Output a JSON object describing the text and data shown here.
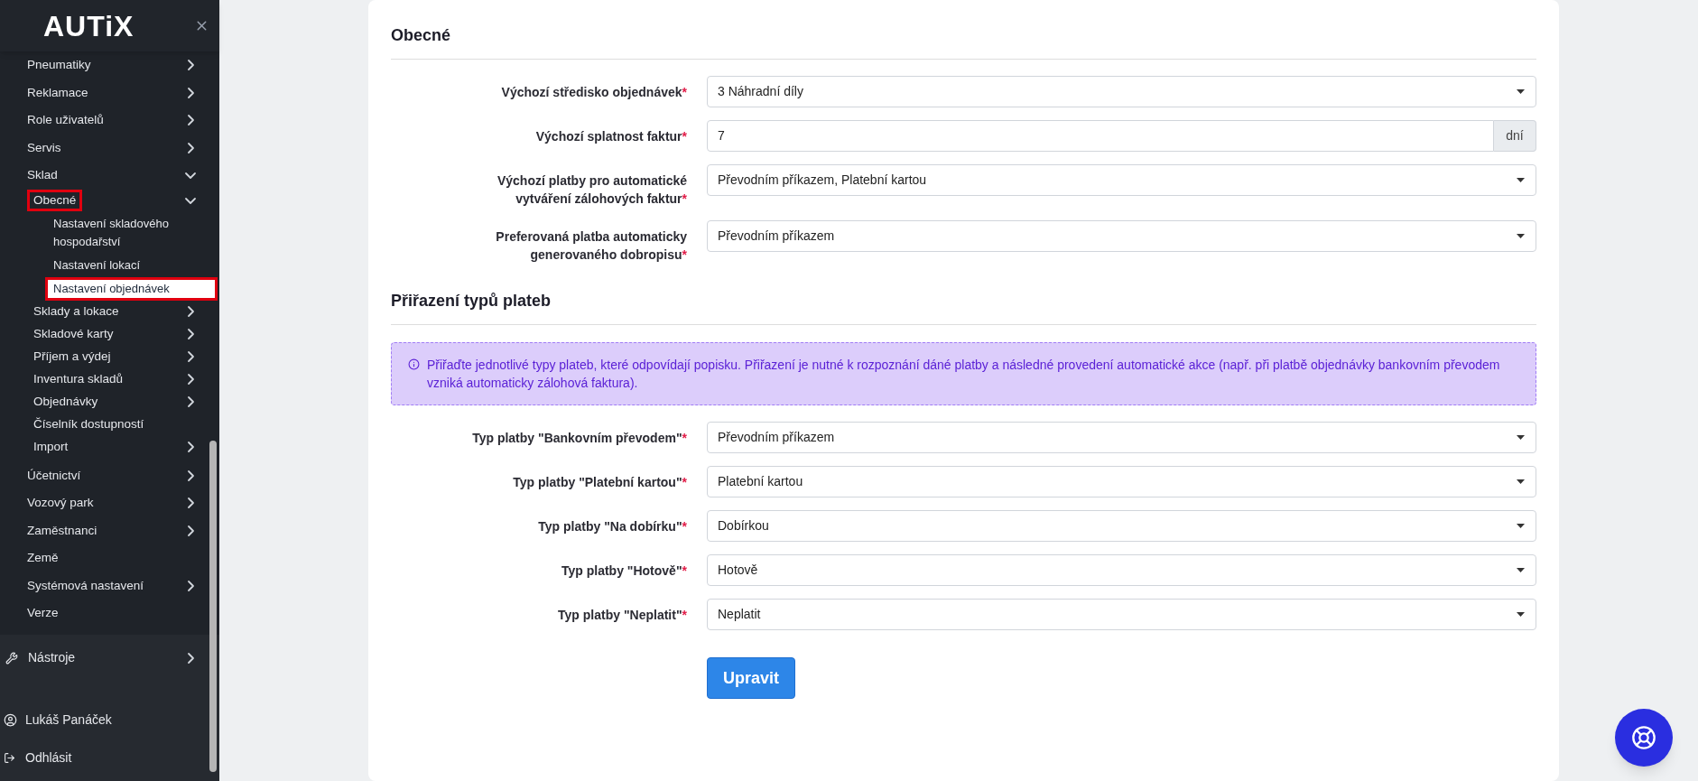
{
  "sidebar": {
    "logo": "AUTiX",
    "items": [
      {
        "label": "Pneumatiky",
        "expanded": false
      },
      {
        "label": "Reklamace",
        "expanded": false
      },
      {
        "label": "Role uživatelů",
        "expanded": false
      },
      {
        "label": "Servis",
        "expanded": false
      },
      {
        "label": "Sklad",
        "expanded": true,
        "children": [
          {
            "label": "Obecné",
            "expanded": true,
            "marked": true,
            "children": [
              {
                "label": "Nastavení skladového hospodařství",
                "selected": false,
                "marked": false
              },
              {
                "label": "Nastavení lokací",
                "selected": false,
                "marked": false
              },
              {
                "label": "Nastavení objednávek",
                "selected": true,
                "marked": true
              }
            ]
          },
          {
            "label": "Sklady a lokace",
            "expanded": false,
            "marked": false
          },
          {
            "label": "Skladové karty",
            "expanded": false,
            "marked": false
          },
          {
            "label": "Příjem a výdej",
            "expanded": false,
            "marked": false
          },
          {
            "label": "Inventura skladů",
            "expanded": false,
            "marked": false
          },
          {
            "label": "Objednávky",
            "expanded": false,
            "marked": false
          },
          {
            "label": "Číselník dostupností",
            "marked": false
          },
          {
            "label": "Import",
            "expanded": false,
            "marked": false
          }
        ]
      },
      {
        "label": "Účetnictví",
        "expanded": false
      },
      {
        "label": "Vozový park",
        "expanded": false
      },
      {
        "label": "Zaměstnanci",
        "expanded": false
      },
      {
        "label": "Země"
      },
      {
        "label": "Systémová nastavení",
        "expanded": false
      },
      {
        "label": "Verze"
      }
    ],
    "tools": {
      "label": "Nástroje",
      "expanded": false
    },
    "user": "Lukáš Panáček",
    "logout": "Odhlásit"
  },
  "sections": [
    {
      "title": "Obecné",
      "fields": [
        {
          "kind": "select",
          "label": "Výchozí středisko objednávek",
          "required_mark": "*",
          "value": "3 Náhradní díly"
        },
        {
          "kind": "suffix",
          "label": "Výchozí splatnost faktur",
          "required_mark": "*",
          "value": "7",
          "suffix": "dní"
        },
        {
          "kind": "select",
          "label": "Výchozí platby pro automatické vytváření zálohových faktur",
          "required_mark": "*",
          "value": "Převodním příkazem, Platební kartou"
        },
        {
          "kind": "select",
          "label": "Preferovaná platba automaticky generovaného dobropisu",
          "required_mark": "*",
          "value": "Převodním příkazem"
        }
      ]
    },
    {
      "title": "Přiřazení typů plateb",
      "info": "Přiřaďte jednotlivé typy plateb, které odpovídají popisku. Přiřazení je nutné k rozpoznání dáné platby a následné provedení automatické akce (např. při platbě objednávky bankovním převodem vzniká automaticky zálohová faktura).",
      "fields": [
        {
          "kind": "select",
          "label": "Typ platby \"Bankovním převodem\"",
          "required_mark": "*",
          "value": "Převodním příkazem"
        },
        {
          "kind": "select",
          "label": "Typ platby \"Platební kartou\"",
          "required_mark": "*",
          "value": "Platební kartou"
        },
        {
          "kind": "select",
          "label": "Typ platby \"Na dobírku\"",
          "required_mark": "*",
          "value": "Dobírkou"
        },
        {
          "kind": "select",
          "label": "Typ platby \"Hotově\"",
          "required_mark": "*",
          "value": "Hotově"
        },
        {
          "kind": "select",
          "label": "Typ platby \"Neplatit\"",
          "required_mark": "*",
          "value": "Neplatit"
        }
      ]
    }
  ],
  "submit": "Upravit"
}
